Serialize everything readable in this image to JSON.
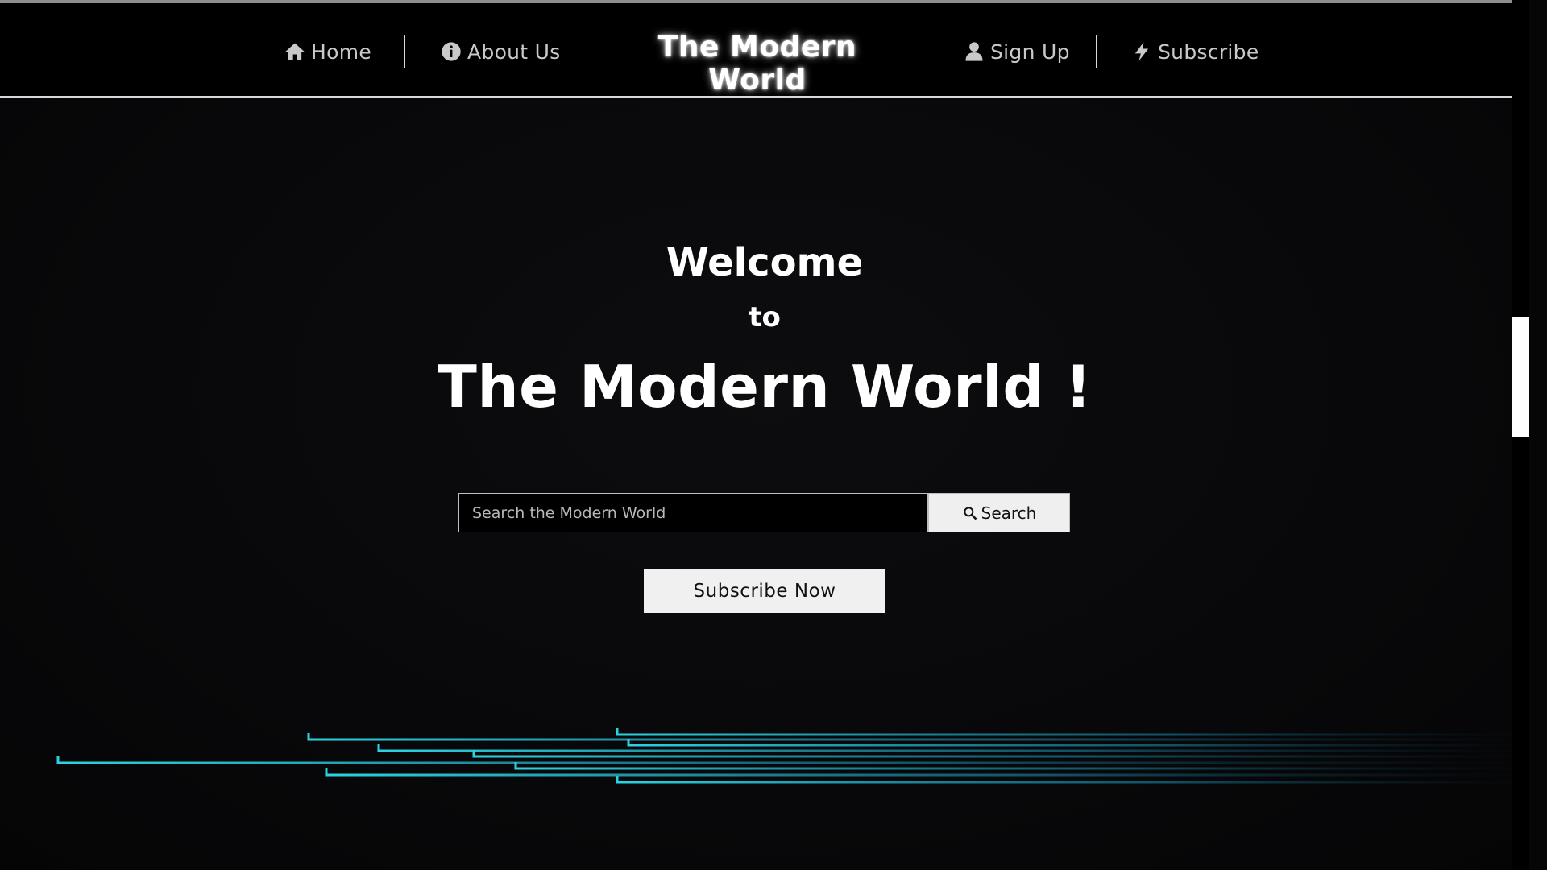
{
  "nav": {
    "home": {
      "label": "Home",
      "icon": "home-icon"
    },
    "about": {
      "label": "About Us",
      "icon": "info-icon"
    },
    "brand": "The Modern World",
    "signup": {
      "label": "Sign Up",
      "icon": "user-icon"
    },
    "subscribe": {
      "label": "Subscribe",
      "icon": "bolt-icon"
    }
  },
  "hero": {
    "welcome": "Welcome",
    "to": "to",
    "title": "The Modern World !"
  },
  "search": {
    "placeholder": "Search the Modern World",
    "value": "",
    "button_label": "Search",
    "button_icon": "search-icon"
  },
  "cta": {
    "subscribe_label": "Subscribe Now"
  },
  "colors": {
    "background": "#060607",
    "nav_text": "#c9c9c9",
    "accent_cyan": "#25c8d6",
    "button_bg": "#f0f0f0"
  }
}
